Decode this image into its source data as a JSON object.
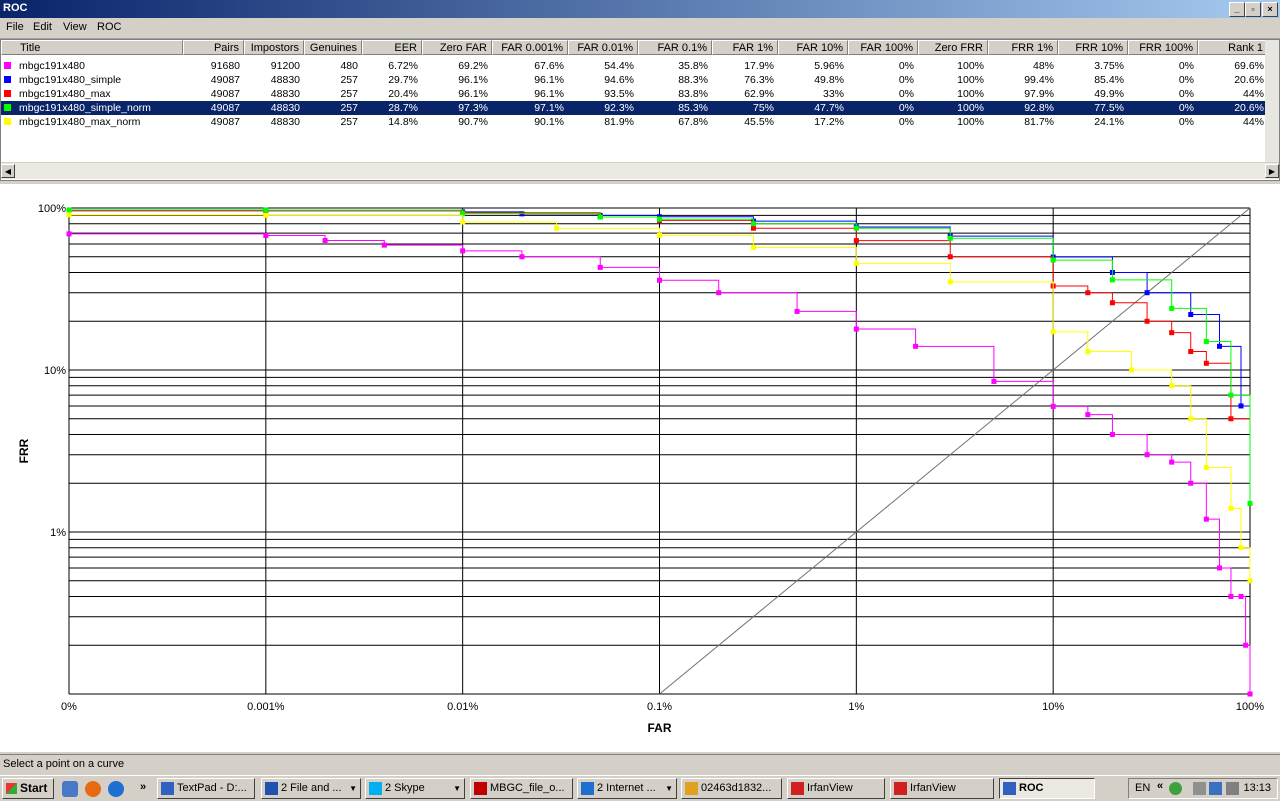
{
  "window": {
    "title": "ROC"
  },
  "menu": [
    "File",
    "Edit",
    "View",
    "ROC"
  ],
  "table": {
    "columns": [
      "Title",
      "Pairs",
      "Impostors",
      "Genuines",
      "EER",
      "Zero FAR",
      "FAR 0.001%",
      "FAR 0.01%",
      "FAR 0.1%",
      "FAR 1%",
      "FAR 10%",
      "FAR 100%",
      "Zero FRR",
      "FRR 1%",
      "FRR 10%",
      "FRR 100%",
      "Rank 1"
    ],
    "rows": [
      {
        "color": "#ff00ff",
        "selected": false,
        "cells": [
          "mbgc191x480",
          "91680",
          "91200",
          "480",
          "6.72%",
          "69.2%",
          "67.6%",
          "54.4%",
          "35.8%",
          "17.9%",
          "5.96%",
          "0%",
          "100%",
          "48%",
          "3.75%",
          "0%",
          "69.6%"
        ]
      },
      {
        "color": "#0000ff",
        "selected": false,
        "cells": [
          "mbgc191x480_simple",
          "49087",
          "48830",
          "257",
          "29.7%",
          "96.1%",
          "96.1%",
          "94.6%",
          "88.3%",
          "76.3%",
          "49.8%",
          "0%",
          "100%",
          "99.4%",
          "85.4%",
          "0%",
          "20.6%"
        ]
      },
      {
        "color": "#ff0000",
        "selected": false,
        "cells": [
          "mbgc191x480_max",
          "49087",
          "48830",
          "257",
          "20.4%",
          "96.1%",
          "96.1%",
          "93.5%",
          "83.8%",
          "62.9%",
          "33%",
          "0%",
          "100%",
          "97.9%",
          "49.9%",
          "0%",
          "44%"
        ]
      },
      {
        "color": "#00ff00",
        "selected": true,
        "cells": [
          "mbgc191x480_simple_norm",
          "49087",
          "48830",
          "257",
          "28.7%",
          "97.3%",
          "97.1%",
          "92.3%",
          "85.3%",
          "75%",
          "47.7%",
          "0%",
          "100%",
          "92.8%",
          "77.5%",
          "0%",
          "20.6%"
        ]
      },
      {
        "color": "#ffff00",
        "selected": false,
        "cells": [
          "mbgc191x480_max_norm",
          "49087",
          "48830",
          "257",
          "14.8%",
          "90.7%",
          "90.1%",
          "81.9%",
          "67.8%",
          "45.5%",
          "17.2%",
          "0%",
          "100%",
          "81.7%",
          "24.1%",
          "0%",
          "44%"
        ]
      }
    ]
  },
  "chart_data": {
    "type": "line",
    "xlabel": "FAR",
    "ylabel": "FRR",
    "x_scale": "log",
    "y_scale": "log",
    "x_ticks": [
      "0%",
      "0.001%",
      "0.01%",
      "0.1%",
      "1%",
      "10%",
      "100%"
    ],
    "y_ticks": [
      "100%",
      "10%",
      "1%"
    ],
    "grid": true,
    "series": [
      {
        "name": "mbgc191x480",
        "color": "#ff00ff",
        "x": [
          0.0,
          0.001,
          0.002,
          0.004,
          0.01,
          0.02,
          0.05,
          0.1,
          0.2,
          0.5,
          1,
          2,
          5,
          10,
          15,
          20,
          30,
          40,
          50,
          60,
          70,
          80,
          90,
          95,
          100
        ],
        "y": [
          69.2,
          67.6,
          63,
          59,
          54.4,
          50,
          43,
          35.8,
          30,
          23,
          17.9,
          14,
          8.5,
          5.96,
          5.3,
          4,
          3,
          2.7,
          2,
          1.2,
          0.6,
          0.4,
          0.4,
          0.2,
          0.1
        ]
      },
      {
        "name": "mbgc191x480_simple",
        "color": "#0000ff",
        "x": [
          0.0,
          0.001,
          0.01,
          0.02,
          0.05,
          0.1,
          0.3,
          1,
          3,
          10,
          20,
          30,
          50,
          70,
          90,
          100
        ],
        "y": [
          96.1,
          96.1,
          94.6,
          92,
          90,
          88.3,
          83,
          76.3,
          67,
          49.8,
          40,
          30,
          22,
          14,
          6,
          1.5
        ]
      },
      {
        "name": "mbgc191x480_max",
        "color": "#ff0000",
        "x": [
          0.0,
          0.001,
          0.01,
          0.05,
          0.1,
          0.3,
          1,
          3,
          10,
          15,
          20,
          30,
          40,
          50,
          60,
          80,
          100
        ],
        "y": [
          96.1,
          96.1,
          93.5,
          88,
          83.8,
          75,
          62.9,
          50,
          33,
          30,
          26,
          20,
          17,
          13,
          11,
          5,
          1.5
        ]
      },
      {
        "name": "mbgc191x480_simple_norm",
        "color": "#00ff00",
        "x": [
          0.0,
          0.001,
          0.01,
          0.05,
          0.1,
          0.3,
          1,
          3,
          10,
          20,
          40,
          60,
          80,
          100
        ],
        "y": [
          97.3,
          97.1,
          92.3,
          88,
          85.3,
          80,
          75,
          65,
          47.7,
          36,
          24,
          15,
          7,
          1.5
        ]
      },
      {
        "name": "mbgc191x480_max_norm",
        "color": "#ffff00",
        "x": [
          0.0,
          0.001,
          0.01,
          0.03,
          0.1,
          0.3,
          1,
          3,
          10,
          15,
          25,
          40,
          50,
          60,
          80,
          90,
          100
        ],
        "y": [
          90.7,
          90.1,
          81.9,
          75,
          67.8,
          57,
          45.5,
          35,
          17.2,
          13,
          10,
          8,
          5,
          2.5,
          1.4,
          0.8,
          0.5
        ]
      }
    ]
  },
  "status": {
    "text": "Select a point on a curve"
  },
  "taskbar": {
    "start": "Start",
    "items": [
      {
        "label": "TextPad - D:...",
        "icon_color": "#3060c0",
        "arrow": false,
        "active": false
      },
      {
        "label": "2 File and ...",
        "icon_color": "#2050b0",
        "arrow": true,
        "active": false
      },
      {
        "label": "2 Skype",
        "icon_color": "#00aff0",
        "arrow": true,
        "active": false
      },
      {
        "label": "MBGC_file_o...",
        "icon_color": "#c00000",
        "arrow": false,
        "active": false
      },
      {
        "label": "2 Internet ...",
        "icon_color": "#1e6fd0",
        "arrow": true,
        "active": false
      },
      {
        "label": "02463d1832...",
        "icon_color": "#e0a020",
        "arrow": false,
        "active": false
      },
      {
        "label": "IrfanView",
        "icon_color": "#d02020",
        "arrow": false,
        "active": false
      },
      {
        "label": "IrfanView",
        "icon_color": "#d02020",
        "arrow": false,
        "active": false
      },
      {
        "label": "ROC",
        "icon_color": "#3060c0",
        "arrow": false,
        "active": true
      }
    ],
    "lang": "EN",
    "clock": "13:13"
  }
}
